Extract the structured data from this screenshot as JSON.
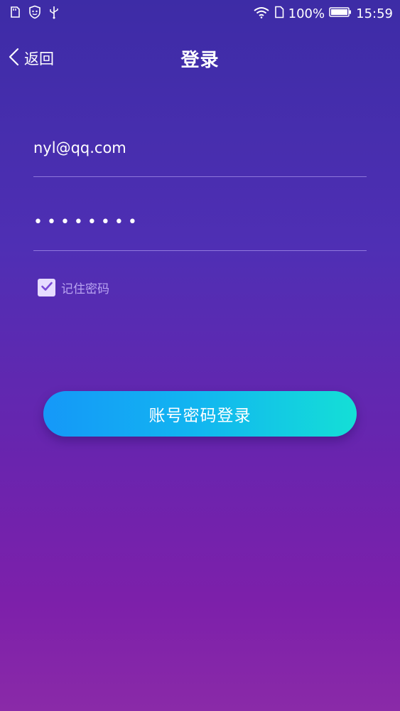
{
  "status_bar": {
    "battery_percent": "100%",
    "time": "15:59",
    "icons": [
      "sd-card-icon",
      "shield-face-icon",
      "usb-icon",
      "wifi-icon",
      "sim-icon",
      "battery-icon"
    ]
  },
  "nav": {
    "back_label": "返回",
    "title": "登录"
  },
  "form": {
    "email_value": "nyl@qq.com",
    "password_value": "••••••••",
    "remember_label": "记住密码",
    "remember_checked": true,
    "login_button_label": "账号密码登录"
  },
  "colors": {
    "background_top": "#3d2ca6",
    "background_bottom": "#8a2aa8",
    "button_start": "#1598f8",
    "button_end": "#14dfd6",
    "checkbox_bg": "#e6dcff",
    "checkmark": "#7a4ad6"
  }
}
